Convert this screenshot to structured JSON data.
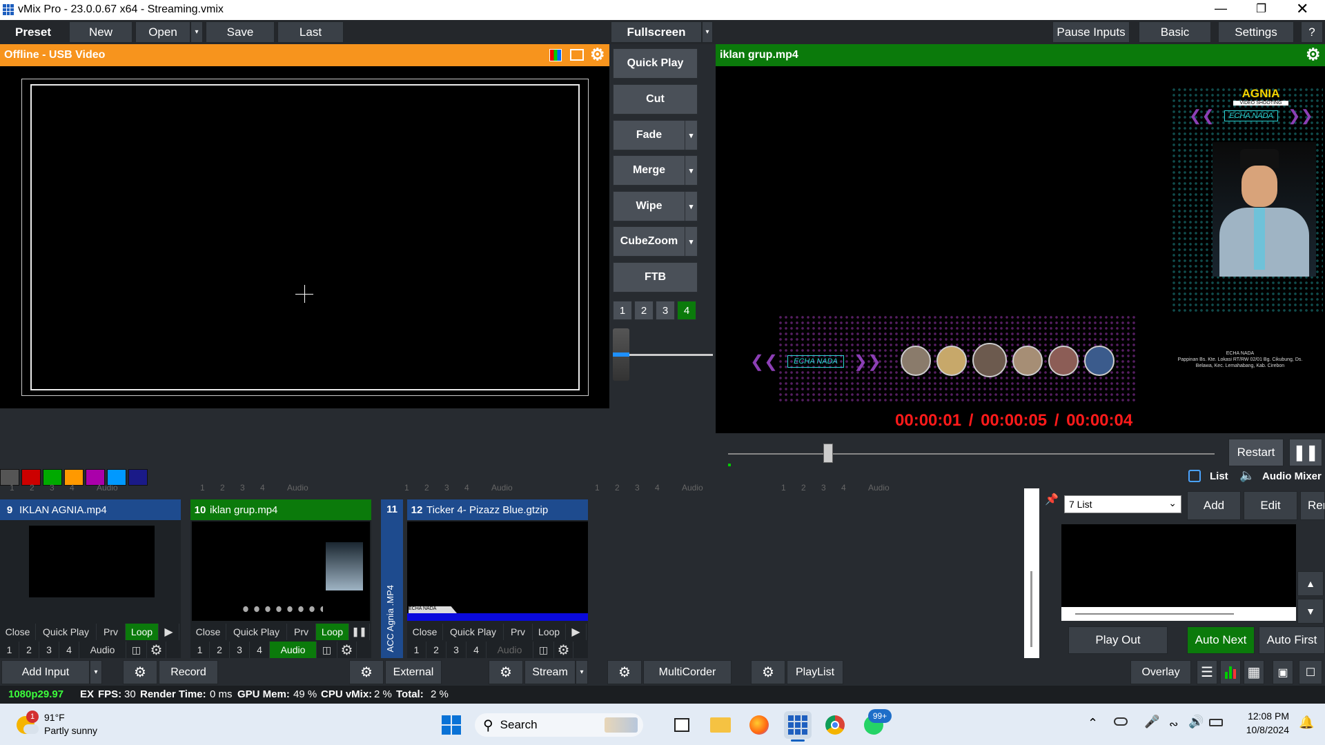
{
  "window": {
    "title": "vMix Pro - 23.0.0.67 x64 - Streaming.vmix"
  },
  "menu": {
    "preset": "Preset",
    "new": "New",
    "open": "Open",
    "save": "Save",
    "last": "Last",
    "fullscreen": "Fullscreen",
    "pause_inputs": "Pause Inputs",
    "basic": "Basic",
    "settings": "Settings",
    "help": "?"
  },
  "preview": {
    "title": "Offline - USB Video"
  },
  "program": {
    "title": "iklan grup.mp4",
    "timecode": "00:00:01 / 00:00:05 / 00:00:04",
    "restart": "Restart",
    "overlay": {
      "logo": "AGNIA",
      "logo_sub": "VIDEO SHOOTING",
      "brand": "ECHA NADA",
      "address_name": "ECHA NADA",
      "address": "Pappinan Bs. Kte. Lokasi RT/RW 02/01 Bg. Cikubung, Ds. Belawa, Kec. Lemahabang, Kab. Cirebon"
    }
  },
  "transitions": {
    "quick_play": "Quick Play",
    "cut": "Cut",
    "fade": "Fade",
    "merge": "Merge",
    "wipe": "Wipe",
    "cubezoom": "CubeZoom",
    "ftb": "FTB",
    "numbers": [
      "1",
      "2",
      "3",
      "4"
    ]
  },
  "color_swatches": [
    "#555555",
    "#cc0000",
    "#00aa00",
    "#ff9900",
    "#aa00aa",
    "#0099ff",
    "#1a1a88"
  ],
  "inputs": [
    {
      "number": "9",
      "name": "IKLAN AGNIA.mp4",
      "buttons": [
        "Close",
        "Quick Play",
        "Prv",
        "Loop"
      ],
      "sub": [
        "1",
        "2",
        "3",
        "4",
        "Audio"
      ]
    },
    {
      "number": "10",
      "name": "iklan grup.mp4",
      "buttons": [
        "Close",
        "Quick Play",
        "Prv",
        "Loop"
      ],
      "sub": [
        "1",
        "2",
        "3",
        "4",
        "Audio"
      ]
    },
    {
      "number": "11",
      "name": "ACC Agnia .MP4"
    },
    {
      "number": "12",
      "name": "Ticker 4- Pizazz Blue.gtzip",
      "buttons": [
        "Close",
        "Quick Play",
        "Prv",
        "Loop"
      ],
      "sub": [
        "1",
        "2",
        "3",
        "4",
        "Audio"
      ],
      "ticker_text": "ECHA NADA"
    }
  ],
  "strip": {
    "nums": [
      "1",
      "2",
      "3",
      "4"
    ],
    "audio": "Audio"
  },
  "playlist": {
    "tabs": {
      "list": "List",
      "audio_mixer": "Audio Mixer"
    },
    "select": "7 List",
    "add": "Add",
    "edit": "Edit",
    "remove": "Ren",
    "play_out": "Play Out",
    "auto_next": "Auto Next",
    "auto_first": "Auto First"
  },
  "bottom": {
    "add_input": "Add Input",
    "record": "Record",
    "external": "External",
    "stream": "Stream",
    "multicorder": "MultiCorder",
    "playlist": "PlayList",
    "overlay": "Overlay"
  },
  "status": {
    "format": "1080p29.97",
    "ex": "EX",
    "fps_label": "FPS:",
    "fps": "30",
    "render_label": "Render Time:",
    "render": "0 ms",
    "gpu_label": "GPU Mem:",
    "gpu": "49 %",
    "cpu_label": "CPU vMix:",
    "cpu": "2 %",
    "total_label": "Total:",
    "total": "2 %"
  },
  "taskbar": {
    "weather_temp": "91°F",
    "weather_desc": "Partly sunny",
    "weather_badge": "1",
    "search": "Search",
    "whatsapp_badge": "99+",
    "time": "12:08 PM",
    "date": "10/8/2024"
  }
}
